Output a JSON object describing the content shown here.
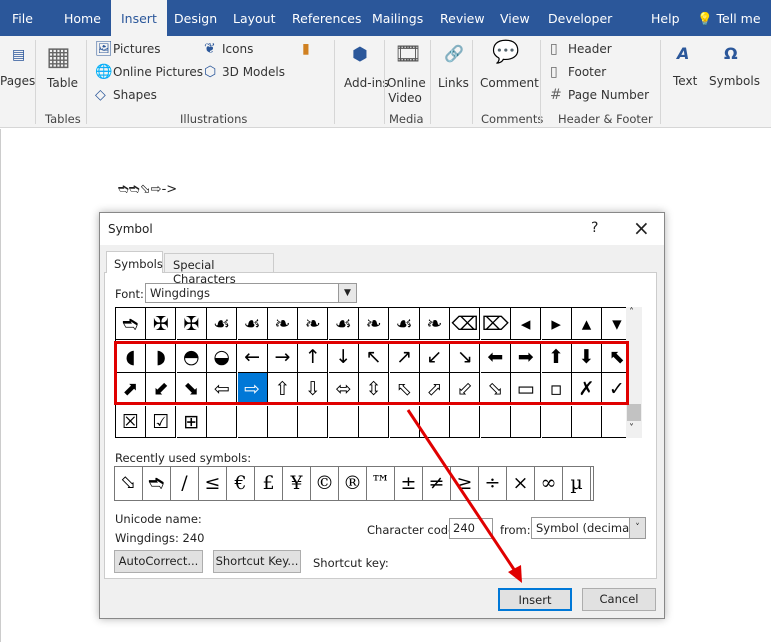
{
  "ribbon": {
    "tabs": [
      "File",
      "Home",
      "Insert",
      "Design",
      "Layout",
      "References",
      "Mailings",
      "Review",
      "View",
      "Developer",
      "Help",
      "Tell me"
    ],
    "active_tab": "Insert",
    "items": {
      "pages": "Pages",
      "table": "Table",
      "pictures": "Pictures",
      "online_pictures": "Online Pictures",
      "shapes": "Shapes",
      "icons": "Icons",
      "models": "3D Models",
      "addins": "Add-ins",
      "online_video": "Online Video",
      "links": "Links",
      "comment": "Comment",
      "header": "Header",
      "footer": "Footer",
      "page_number": "Page Number",
      "text": "Text",
      "symbols": "Symbols"
    },
    "groups": {
      "tables": "Tables",
      "illustrations": "Illustrations",
      "media": "Media",
      "comments": "Comments",
      "header_footer": "Header & Footer"
    }
  },
  "document": {
    "text": "➬➬⬂⇨->"
  },
  "dialog": {
    "title": "Symbol",
    "help": "?",
    "close": "×",
    "tabs": [
      "Symbols",
      "Special Characters"
    ],
    "font_label": "Font:",
    "font_value": "Wingdings",
    "grid": [
      [
        "➬",
        "✠",
        "✠",
        "☙",
        "☙",
        "❧",
        "❧",
        "☙",
        "❧",
        "☙",
        "❧",
        "⌫",
        "⌦",
        "◂",
        "▸",
        "▴",
        "▾"
      ],
      [
        "◖",
        "◗",
        "◓",
        "◒",
        "←",
        "→",
        "↑",
        "↓",
        "↖",
        "↗",
        "↙",
        "↘",
        "⬅",
        "➡",
        "⬆",
        "⬇",
        "⬉"
      ],
      [
        "⬈",
        "⬋",
        "⬊",
        "⇦",
        "⇨",
        "⇧",
        "⇩",
        "⬄",
        "⇳",
        "⬁",
        "⬀",
        "⬃",
        "⬂",
        "▭",
        "▫",
        "✗",
        "✓"
      ],
      [
        "☒",
        "☑",
        "⊞",
        "",
        "",
        "",
        "",
        "",
        "",
        "",
        "",
        "",
        "",
        "",
        "",
        "",
        ""
      ]
    ],
    "selected": {
      "row": 2,
      "col": 4
    },
    "recent_label": "Recently used symbols:",
    "recent": [
      "⬂",
      "➬",
      "/",
      "≤",
      "€",
      "£",
      "¥",
      "©",
      "®",
      "™",
      "±",
      "≠",
      "≥",
      "÷",
      "×",
      "∞",
      "µ"
    ],
    "unicode_name_label": "Unicode name:",
    "unicode_name": "Wingdings: 240",
    "char_code_label": "Character code:",
    "char_code": "240",
    "from_label": "from:",
    "from_value": "Symbol (decimal)",
    "autocorrect": "AutoCorrect...",
    "shortcut_key_btn": "Shortcut Key...",
    "shortcut_key_label": "Shortcut key:",
    "insert": "Insert",
    "cancel": "Cancel"
  },
  "colors": {
    "accent": "#2b579a",
    "highlight": "#e00000",
    "selection": "#0078d7"
  }
}
